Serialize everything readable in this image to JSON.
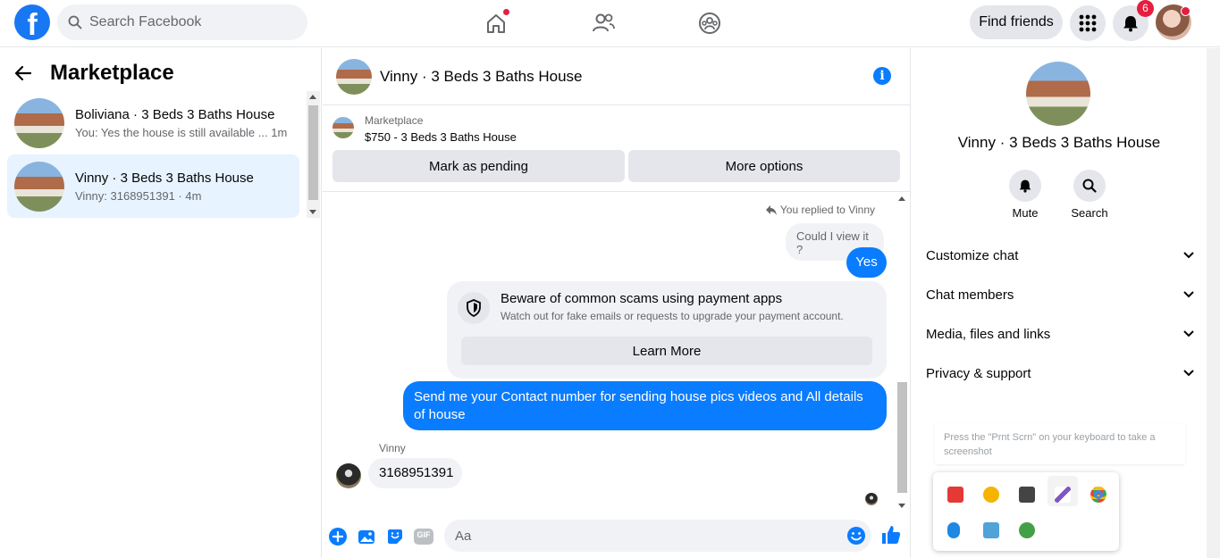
{
  "topbar": {
    "logo": "f",
    "search_placeholder": "Search Facebook",
    "find_friends_label": "Find friends",
    "notifications_count": "6"
  },
  "left": {
    "title": "Marketplace",
    "conversations": [
      {
        "name": "Boliviana · 3 Beds 3 Baths House",
        "preview": "You: Yes the house is still available ... 1m"
      },
      {
        "name": "Vinny · 3 Beds 3 Baths House",
        "preview": "Vinny: 3168951391 · 4m"
      }
    ]
  },
  "chat": {
    "title": "Vinny · 3 Beds 3 Baths House",
    "info_icon": "i",
    "listing_label": "Marketplace",
    "listing_price": "$750 - 3 Beds 3 Baths House",
    "mark_pending_label": "Mark as pending",
    "more_options_label": "More options",
    "replied_to": "You replied to Vinny",
    "quoted_message": "Could I view it ?",
    "reply_message": "Yes",
    "scam_title": "Beware of common scams using payment apps",
    "scam_subtitle": "Watch out for fake emails or requests to upgrade your payment account.",
    "learn_more_label": "Learn More",
    "sent_message": "Send me your Contact number for sending house pics videos and All details of house",
    "sender_name": "Vinny",
    "received_message": "3168951391",
    "composer_placeholder": "Aa",
    "gif_label": "GIF"
  },
  "right": {
    "name": "Vinny · 3 Beds 3 Baths House",
    "actions": [
      {
        "label": "Mute",
        "icon": "bell-icon"
      },
      {
        "label": "Search",
        "icon": "search-icon"
      }
    ],
    "sections": [
      "Customize chat",
      "Chat members",
      "Media, files and links",
      "Privacy & support"
    ]
  },
  "tooltip": "Press the \"Prnt Scrn\" on your keyboard to take a screenshot",
  "colors": {
    "brand": "#1877f2",
    "messenger_blue": "#0a7cff",
    "badge_red": "#e41e3f",
    "active_row": "#e7f3ff"
  }
}
